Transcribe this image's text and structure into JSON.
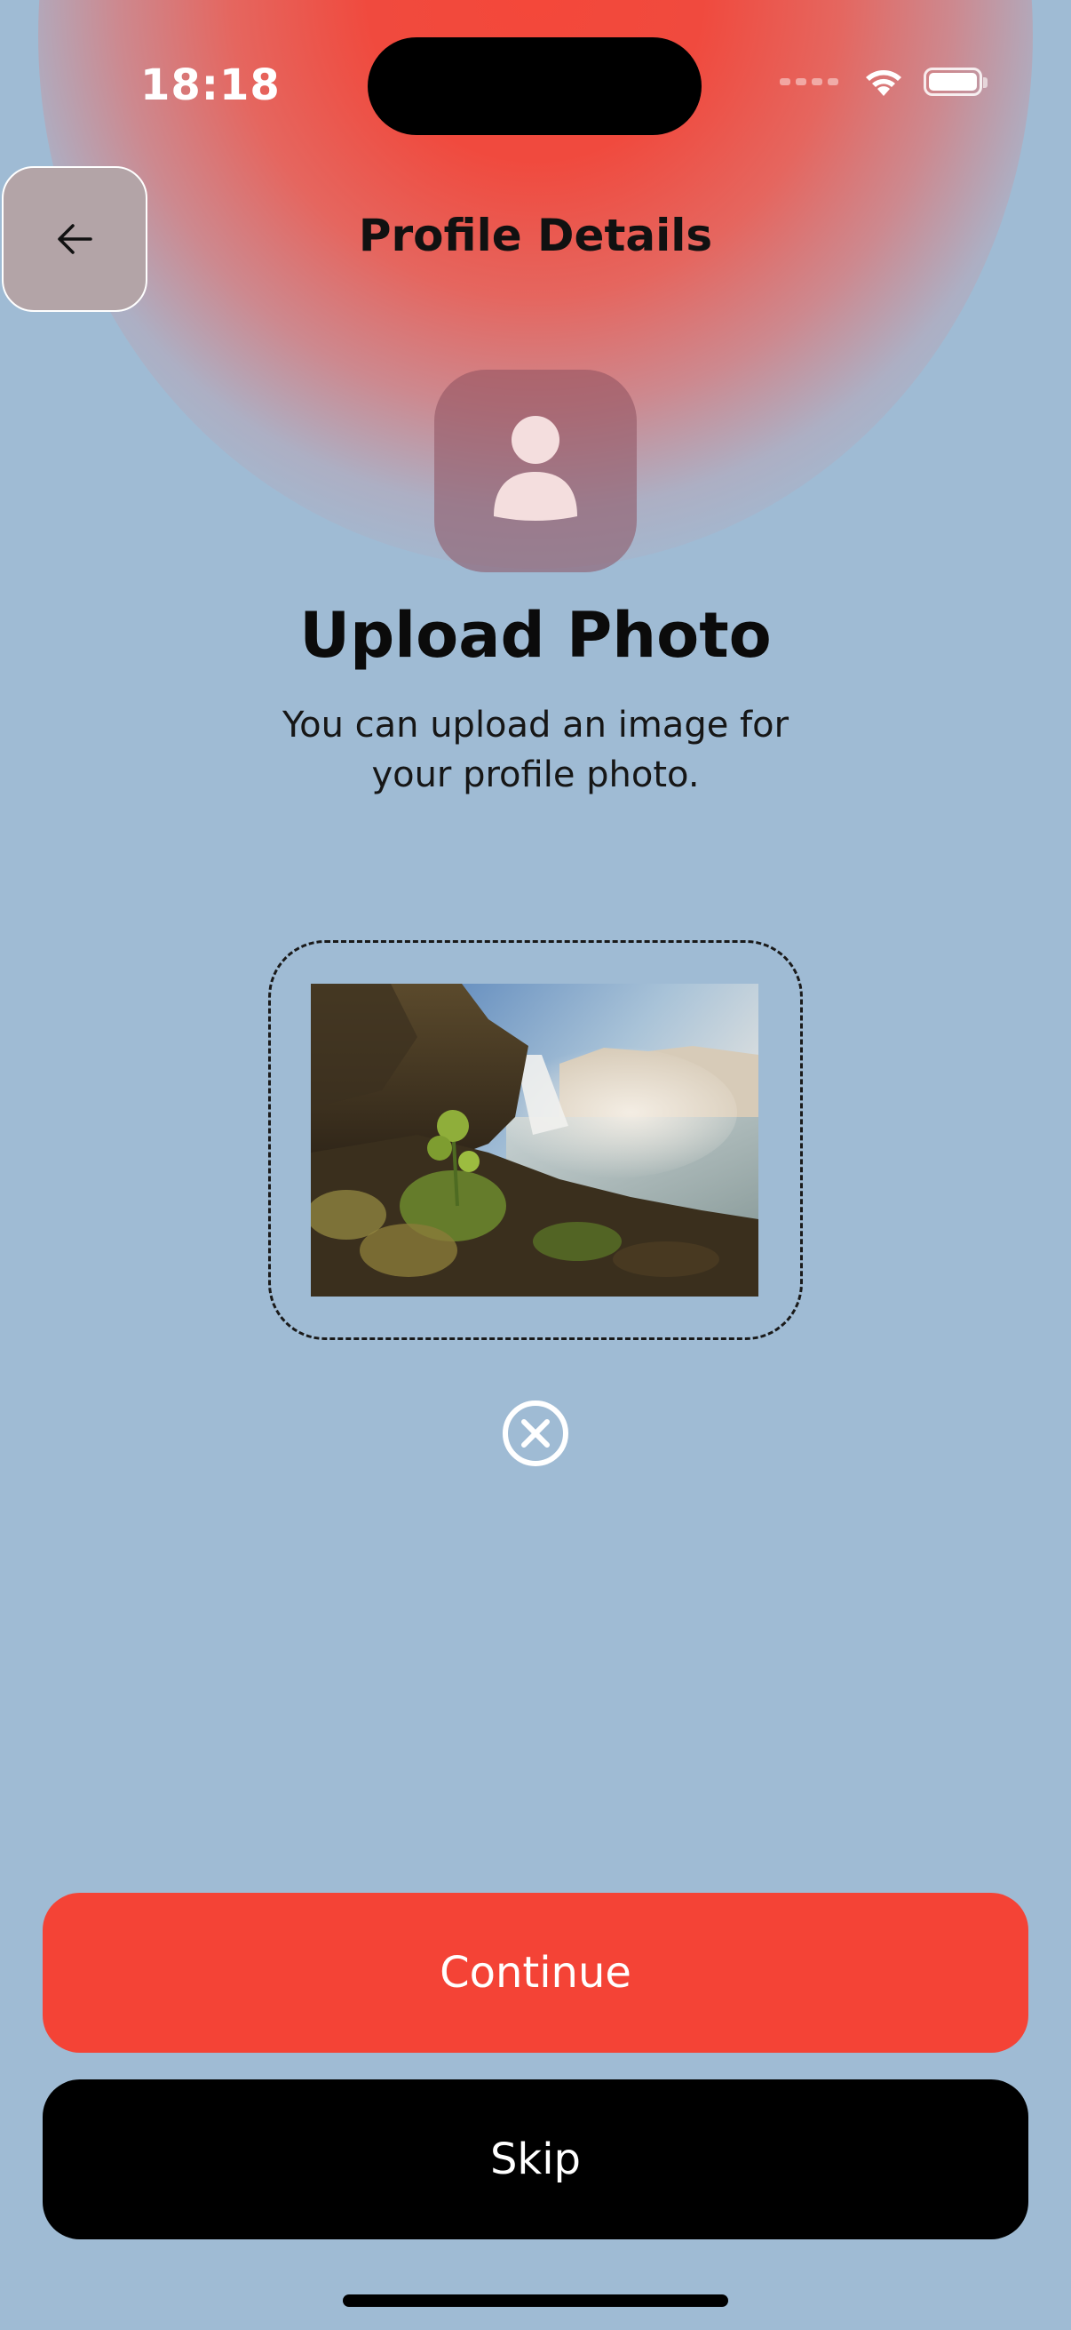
{
  "status_bar": {
    "time": "18:18",
    "wifi_icon": "wifi-icon",
    "battery_icon": "battery-icon"
  },
  "header": {
    "title": "Profile Details",
    "back_icon": "arrow-left-icon"
  },
  "avatar": {
    "icon": "user-icon"
  },
  "upload": {
    "title": "Upload Photo",
    "subtitle": "You can upload an image for your profile photo.",
    "photo_description": "waterfall-photo",
    "remove_icon": "close-circle-icon"
  },
  "actions": {
    "continue_label": "Continue",
    "skip_label": "Skip"
  },
  "colors": {
    "background": "#9fbbd4",
    "accent": "#f44336",
    "skip_bg": "#000000"
  }
}
